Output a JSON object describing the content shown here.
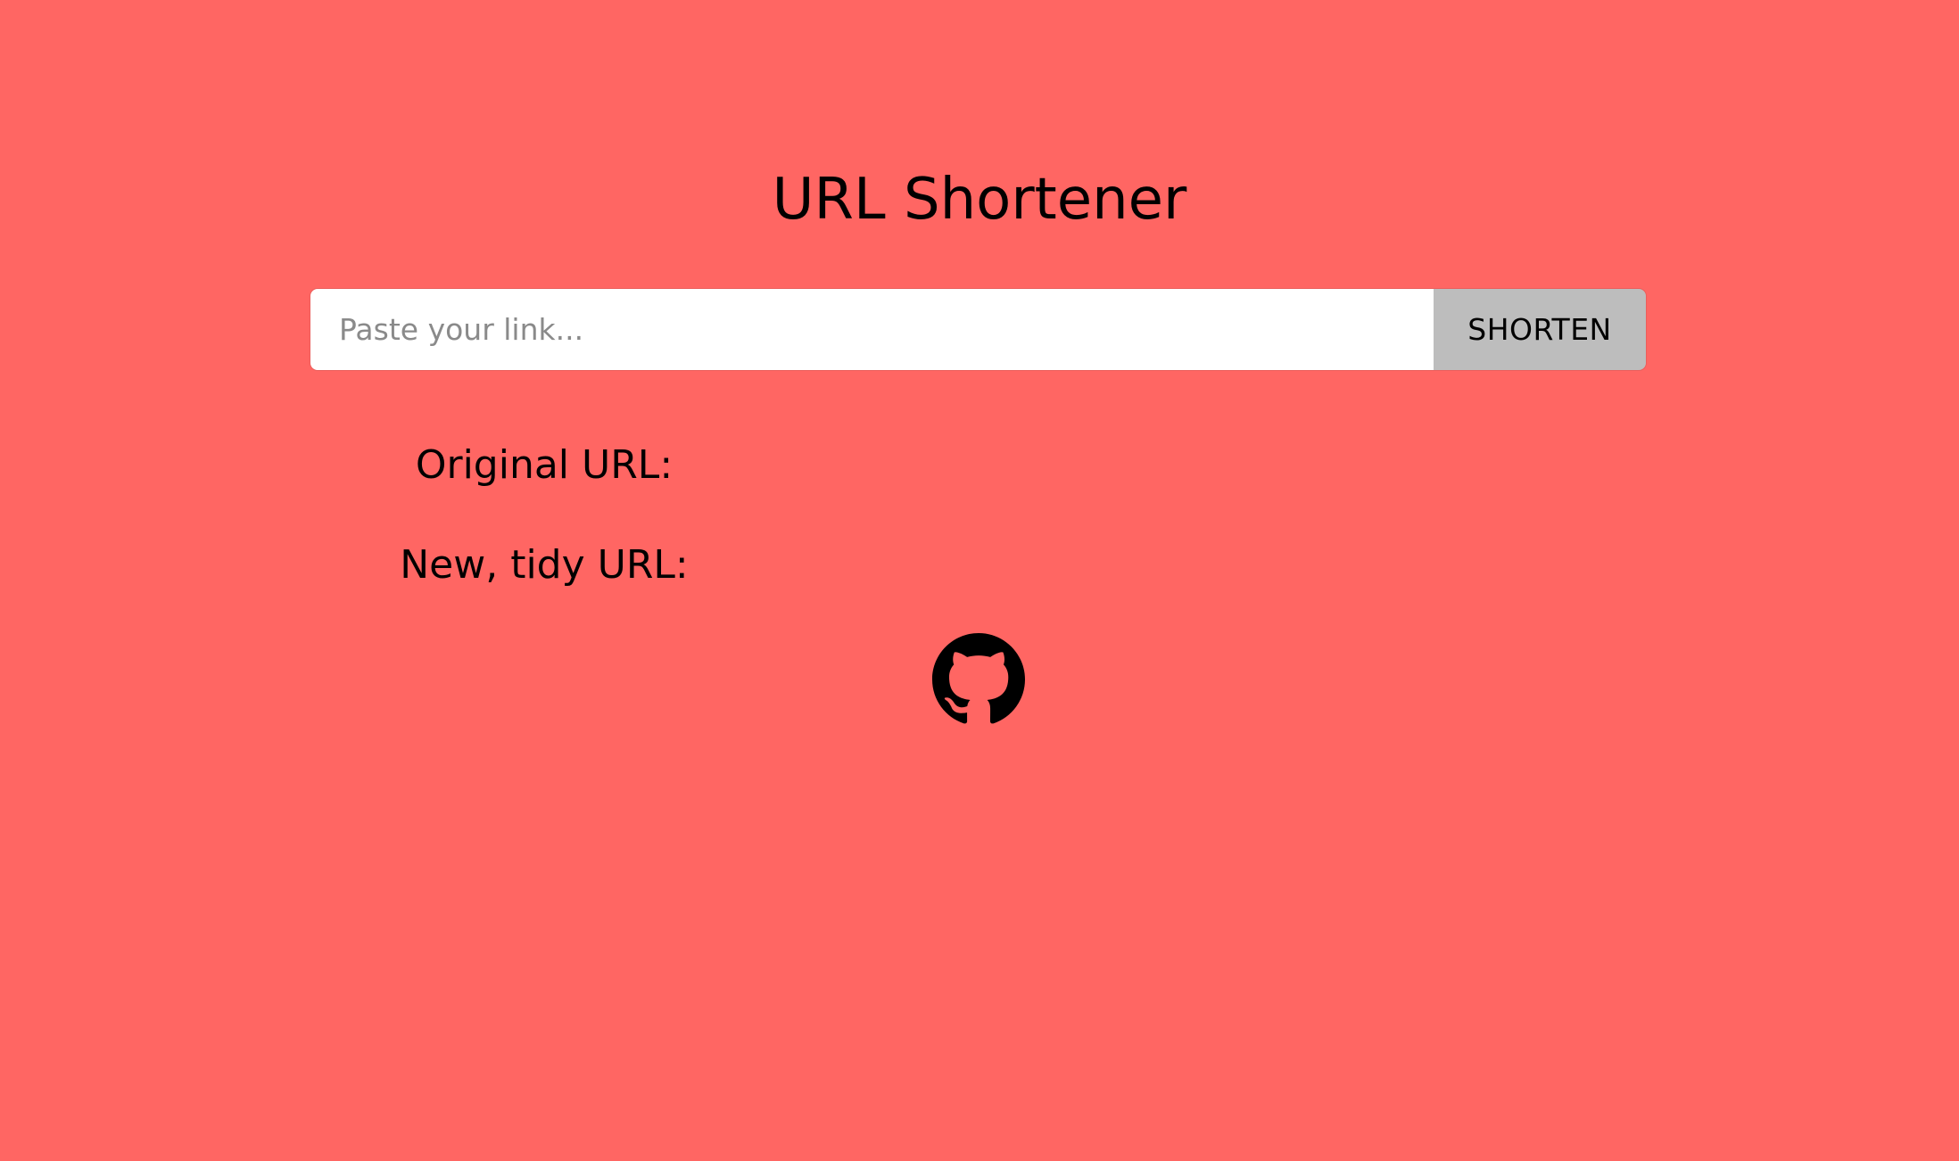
{
  "header": {
    "title": "URL Shortener"
  },
  "form": {
    "input_value": "",
    "input_placeholder": "Paste your link...",
    "submit_label": "SHORTEN"
  },
  "results": {
    "original_label": "Original URL:",
    "new_label": "New, tidy URL:"
  },
  "footer": {
    "github_icon": "github-icon"
  },
  "colors": {
    "background": "#ff6663",
    "button_background": "#bdbdbd",
    "input_background": "#ffffff",
    "placeholder_text": "#8a8a8a",
    "text": "#000000"
  }
}
